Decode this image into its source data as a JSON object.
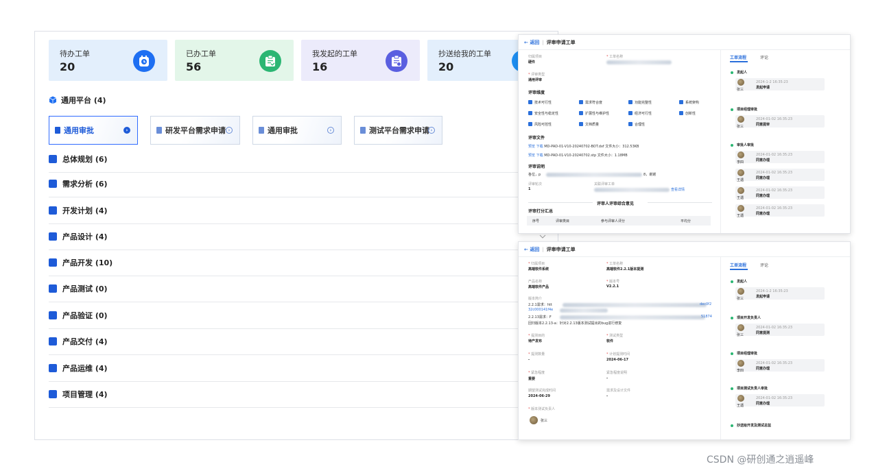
{
  "stats": [
    {
      "label": "待办工单",
      "value": "20",
      "bg": "#e3effc",
      "icon_color": "#1e6ff2",
      "icon": "calendar-clock-icon"
    },
    {
      "label": "已办工单",
      "value": "56",
      "bg": "#e3f6e9",
      "icon_color": "#2bb673",
      "icon": "clipboard-check-icon"
    },
    {
      "label": "我发起的工单",
      "value": "16",
      "bg": "#ecebfb",
      "icon_color": "#5a5fe0",
      "icon": "clipboard-add-icon"
    },
    {
      "label": "抄送给我的工单",
      "value": "20",
      "bg": "#e3effc",
      "icon_color": "#1e8ff2",
      "icon": "clipboard-icon"
    }
  ],
  "section": {
    "title": "通用平台 (4)"
  },
  "cards": [
    "通用审批",
    "研发平台需求申请",
    "通用审批",
    "测试平台需求申请"
  ],
  "categories": [
    {
      "label": "总体规划 (6)",
      "color": "#1e6ff2"
    },
    {
      "label": "需求分析 (6)",
      "color": "#1e6ff2"
    },
    {
      "label": "开发计划 (4)",
      "color": "#1e6ff2"
    },
    {
      "label": "产品设计 (4)",
      "color": "#1e6ff2"
    },
    {
      "label": "产品开发 (10)",
      "color": "#1e6ff2"
    },
    {
      "label": "产品测试 (0)",
      "color": "#1e6ff2"
    },
    {
      "label": "产品验证 (0)",
      "color": "#1e6ff2"
    },
    {
      "label": "产品交付 (4)",
      "color": "#1e6ff2"
    },
    {
      "label": "产品运维 (4)",
      "color": "#1e6ff2"
    },
    {
      "label": "项目管理 (4)",
      "color": "#1e6ff2"
    }
  ],
  "panel1": {
    "back": "返回",
    "title": "评审申请工单",
    "project_label": "归属项目",
    "project_value": "硬件",
    "order_name_label": "工单名称",
    "review_type_label": "评审类型",
    "review_type_value": "通用评审",
    "dimension_title": "评审维度",
    "dimensions": [
      "技术可行性",
      "需求符合度",
      "功能完整性",
      "系统架构",
      "安全性与稳定性",
      "扩展性与维护性",
      "经济可行性",
      "创新性",
      "风险可控性",
      "文档质量",
      "合理性"
    ],
    "files_title": "评审文件",
    "files": [
      {
        "actions": "预览 下载",
        "name": "MD-PAD-01-V10-20240702-BOT.dxf",
        "size": "文件大小：312.53KB"
      },
      {
        "actions": "预览 下载",
        "name": "MD-PAD-01-V10-20240702.stp",
        "size": "文件大小：1.18MB"
      }
    ],
    "desc_title": "评审说明",
    "desc_prefix": "各位，p",
    "desc_suffix": "8，谢谢",
    "round_label": "评审轮次",
    "round_value": "1",
    "related_label": "关联评审工单",
    "related_link": "查看详情",
    "opinion_title": "评审人评审综合意见",
    "score_title": "评审打分汇总",
    "table_headers": [
      "序号",
      "评审类目",
      "参与评审人评分",
      "平均分"
    ],
    "tabs": [
      "工单流程",
      "评论"
    ],
    "flow": [
      {
        "step": "发起人",
        "time": "2024-1-2 16:35:23",
        "action": "发起申请",
        "user": "张三"
      },
      {
        "step": "项目经理审批",
        "time": "2024-01-02 16:35:23",
        "action": "同意提审",
        "user": "张三"
      },
      {
        "step": "审批人审批",
        "time": "2024-01-02 16:35:23",
        "action": "同意办理",
        "user": "李四"
      },
      {
        "step": "",
        "time": "2024-01-02 16:35:23",
        "action": "同意办理",
        "user": "王遇"
      },
      {
        "step": "",
        "time": "2024-01-02 16:35:23",
        "action": "同意办理",
        "user": "王遇"
      },
      {
        "step": "",
        "time": "2024-01-02 16:35:23",
        "action": "同意办理",
        "user": "王遇"
      }
    ]
  },
  "panel2": {
    "back": "返回",
    "title": "评审申请工单",
    "f": [
      {
        "label": "归属项目",
        "value": "高端软件系统"
      },
      {
        "label": "工单名称",
        "value": "高端软件2.2.1版本提测"
      },
      {
        "label": "产品名称",
        "value": "高端软件产品"
      },
      {
        "label": "版本号",
        "value": "V2.2.1"
      },
      {
        "label": "提测目的",
        "value": "待产发布"
      },
      {
        "label": "测试类型",
        "value": "软件"
      },
      {
        "label": "提测数量",
        "value": "-"
      },
      {
        "label": "计划提测时间",
        "value": "2024-06-17"
      },
      {
        "label": "紧急程度",
        "value": "重要"
      },
      {
        "label": "紧急程度说明",
        "value": "-"
      },
      {
        "label": "期望测试完成时间",
        "value": "2024-06-29"
      },
      {
        "label": "需求及设计文件",
        "value": "-"
      }
    ],
    "intro_label": "版本简介",
    "req1": "2.2.1需求：htt",
    "req1_tail": "dec0f2",
    "req1_line2": "32c000141f4e",
    "req2": "2.2.13需求：F",
    "req2_tail": "51874",
    "fixline": "回归版本2.2.13-a：针对2.2.13版本测试提出的bug进行修复",
    "owner_label": "版本测试负责人",
    "owner_name": "张三",
    "tabs": [
      "工单流程",
      "评论"
    ],
    "flow": [
      {
        "step": "发起人",
        "time": "2024-1-2 16:35:23",
        "action": "发起申请",
        "user": "张三"
      },
      {
        "step": "项目开发负责人",
        "time": "2024-01-02 16:35:23",
        "action": "同意提测",
        "user": "张三"
      },
      {
        "step": "项目经理审批",
        "time": "2024-01-02 16:35:23",
        "action": "同意办理",
        "user": "李四"
      },
      {
        "step": "项目测试负责人审批",
        "time": "2024-01-02 16:35:23",
        "action": "同意办理",
        "user": "王遇"
      },
      {
        "step": "抄送给开发及测试总监",
        "time": "",
        "action": "",
        "user": ""
      }
    ]
  },
  "watermark": "CSDN @研创通之逍遥峰"
}
